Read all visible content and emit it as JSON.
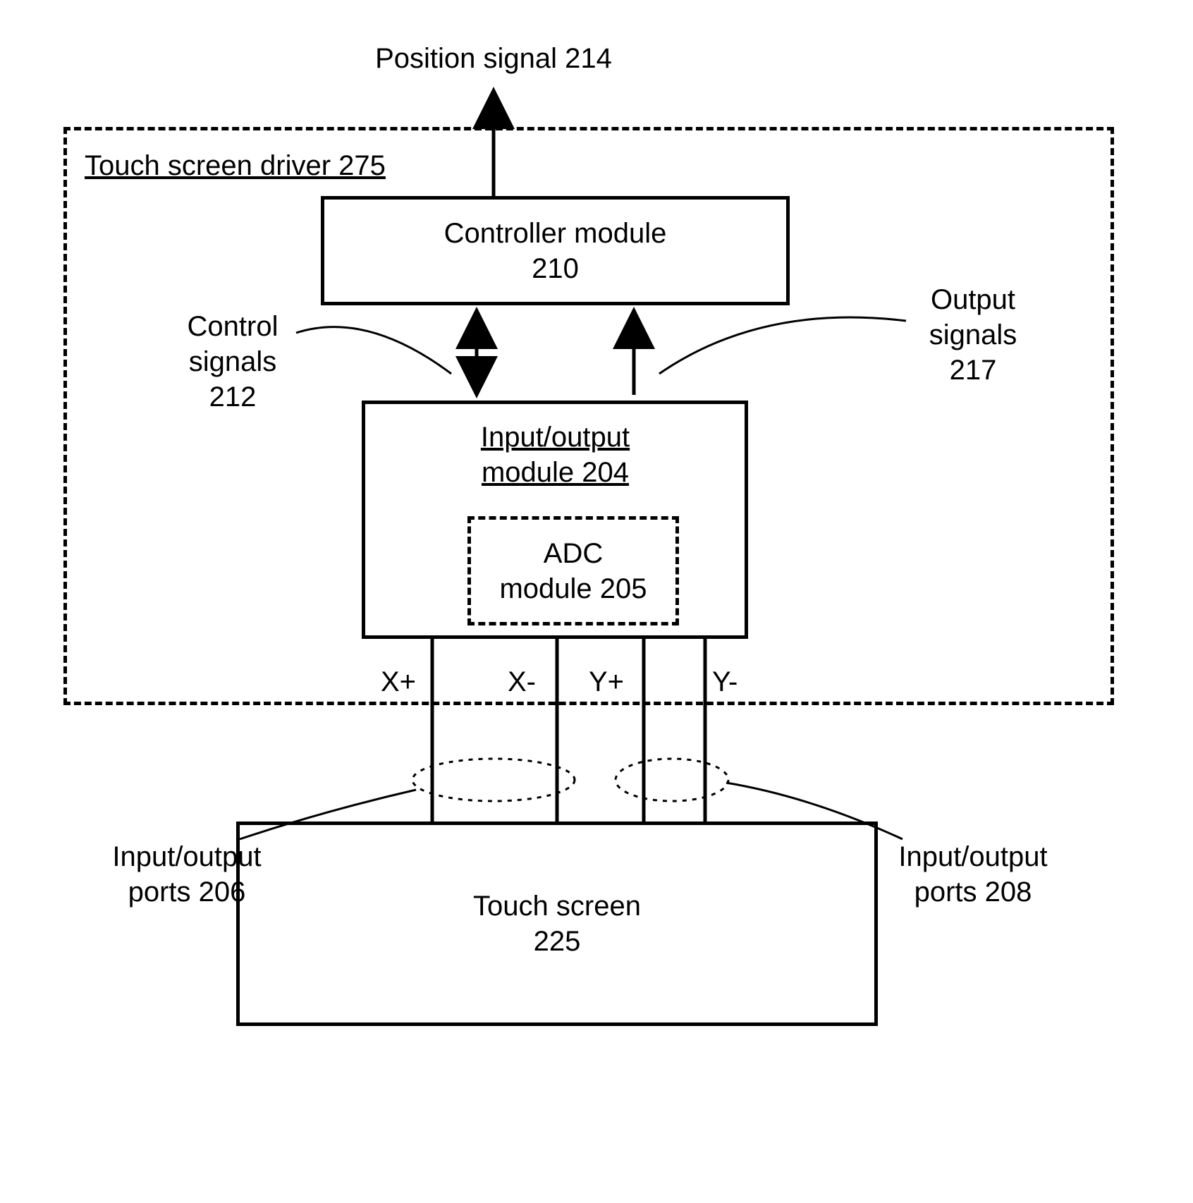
{
  "diagram": {
    "position_signal": "Position signal 214",
    "driver_title": "Touch screen driver 275",
    "controller": {
      "line1": "Controller module",
      "line2": "210"
    },
    "control_signals": {
      "line1": "Control",
      "line2": "signals",
      "line3": "212"
    },
    "output_signals": {
      "line1": "Output",
      "line2": "signals",
      "line3": "217"
    },
    "io_module": {
      "title_line1": "Input/output",
      "title_line2": "module 204"
    },
    "adc": {
      "line1": "ADC",
      "line2": "module 205"
    },
    "ports": {
      "xplus": "X+",
      "xminus": "X-",
      "yplus": "Y+",
      "yminus": "Y-"
    },
    "io_ports_left": {
      "line1": "Input/output",
      "line2": "ports 206"
    },
    "io_ports_right": {
      "line1": "Input/output",
      "line2": "ports 208"
    },
    "touch_screen": {
      "line1": "Touch screen",
      "line2": "225"
    }
  }
}
